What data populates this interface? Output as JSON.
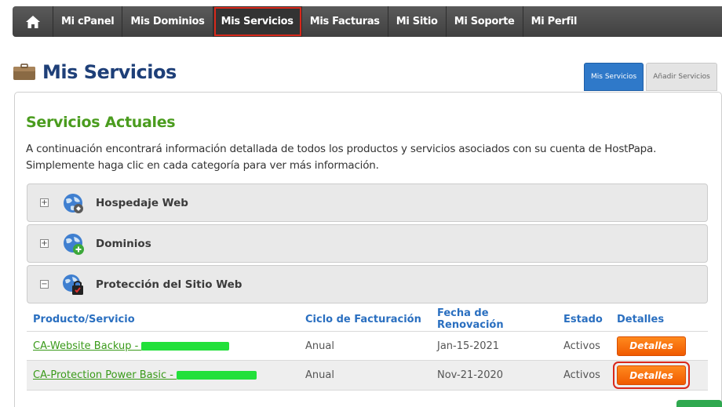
{
  "nav": {
    "home_icon": "house-icon",
    "items": [
      {
        "label": "Mi cPanel"
      },
      {
        "label": "Mis Dominios"
      },
      {
        "label": "Mis Servicios"
      },
      {
        "label": "Mis Facturas"
      },
      {
        "label": "Mi Sitio"
      },
      {
        "label": "Mi Soporte"
      },
      {
        "label": "Mi Perfil"
      }
    ],
    "active_index": 2
  },
  "header": {
    "title": "Mis Servicios",
    "icon": "briefcase-icon"
  },
  "tabs": [
    {
      "label": "Mis Servicios",
      "active": true
    },
    {
      "label": "Añadir Servicios",
      "active": false
    }
  ],
  "section": {
    "title": "Servicios Actuales",
    "intro": "A continuación encontrará información detallada de todos los productos y servicios asociados con su cuenta de HostPapa. Simplemente haga clic en cada categoría para ver más información."
  },
  "accordion": [
    {
      "label": "Hospedaje Web",
      "toggle": "+",
      "icon": "globe-icon"
    },
    {
      "label": "Dominios",
      "toggle": "+",
      "icon": "globe-add-icon"
    },
    {
      "label": "Protección del Sitio Web",
      "toggle": "−",
      "icon": "globe-lock-icon"
    }
  ],
  "table": {
    "headers": [
      "Producto/Servicio",
      "Ciclo de Facturación",
      "Fecha de Renovación",
      "Estado",
      "Detalles"
    ],
    "rows": [
      {
        "product": "CA-Website Backup - ",
        "cycle": "Anual",
        "renewal": "Jan-15-2021",
        "status": "Activos",
        "button": "Detalles"
      },
      {
        "product": "CA-Protection Power Basic - ",
        "cycle": "Anual",
        "renewal": "Nov-21-2020",
        "status": "Activos",
        "button": "Detalles"
      }
    ]
  },
  "colors": {
    "nav_bg": "#4a4a4a",
    "title_blue": "#1e3f78",
    "section_green": "#4a9c1e",
    "button_orange": "#f5700a",
    "highlight_red": "#d9281b",
    "link_green": "#3a9a1a",
    "header_blue": "#2a6fc0"
  }
}
